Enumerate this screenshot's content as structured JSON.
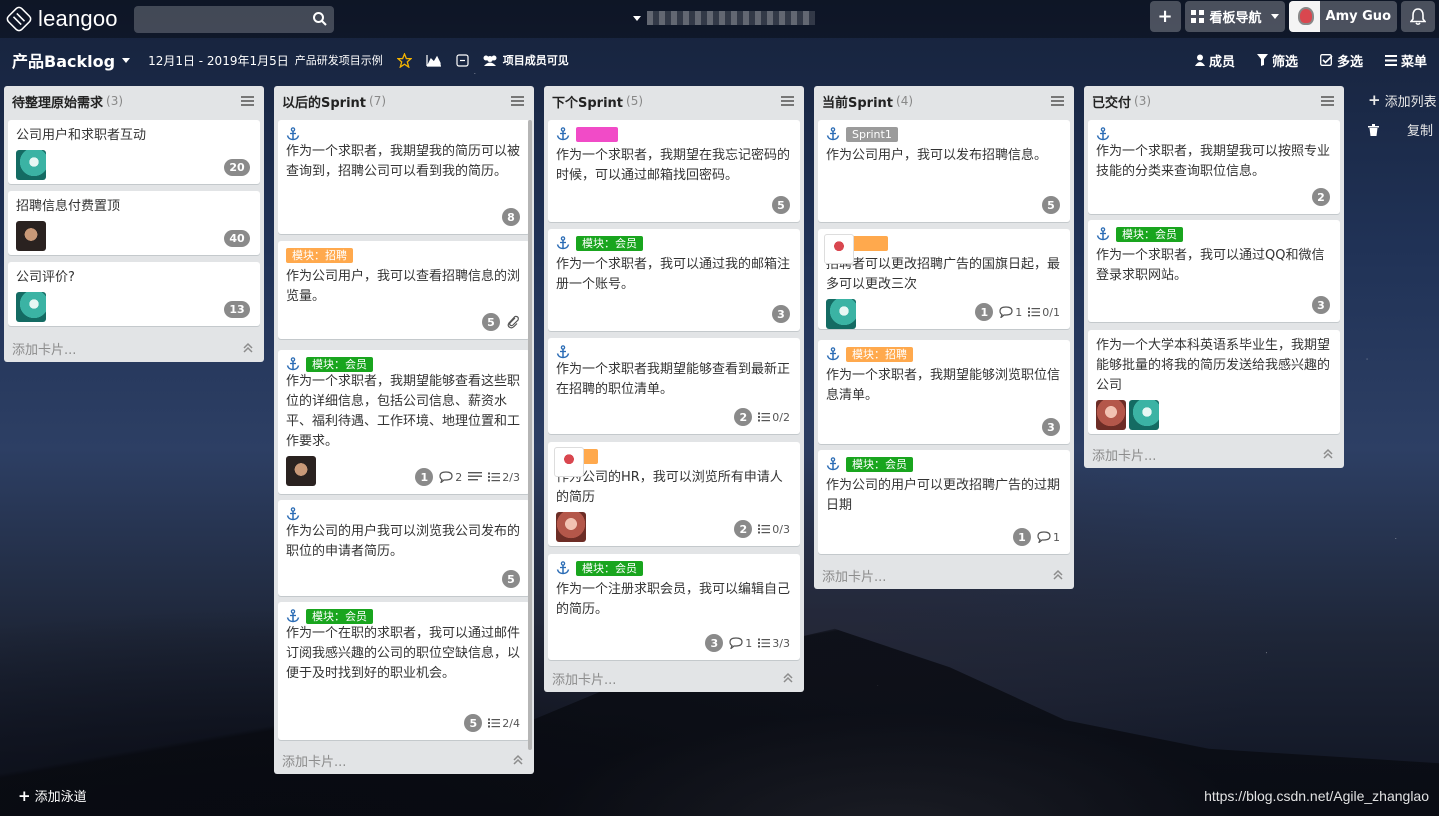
{
  "topbar": {
    "logo_text": "leangoo",
    "search_placeholder": "",
    "board_switch_label": "",
    "nav_label": "看板导航",
    "user_name": "Amy Guo",
    "icons": [
      "search-icon",
      "plus-icon",
      "grid-icon",
      "bell-icon"
    ]
  },
  "board": {
    "title": "产品Backlog",
    "date_range": "12月1日 - 2019年1月5日",
    "description": "产品研发项目示例",
    "visibility": "项目成员可见",
    "actions": [
      "成员",
      "筛选",
      "多选",
      "菜单"
    ]
  },
  "lists": [
    {
      "title": "待整理原始需求",
      "count": "(3)",
      "cards": [
        {
          "text": "公司用户和求职者互动",
          "badge": "20"
        },
        {
          "text": "招聘信息付费置顶",
          "badge": "40"
        },
        {
          "text": "公司评价?",
          "badge": "13"
        }
      ],
      "add_card": "添加卡片..."
    },
    {
      "title": "以后的Sprint",
      "count": "(7)",
      "cards": [
        {
          "text": "作为一个求职者，我期望我的简历可以被查询到，招聘公司可以看到我的简历。",
          "badge": "8"
        },
        {
          "label": "模块：招聘",
          "text": "作为公司用户，我可以查看招聘信息的浏览量。",
          "badge": "5"
        },
        {
          "label": "模块：会员",
          "text": "作为一个求职者，我期望能够查看这些职位的详细信息，包括公司信息、薪资水平、福利待遇、工作环境、地理位置和工作要求。",
          "badge": "1",
          "comments": "2",
          "checklist": "2/3"
        },
        {
          "text": "作为公司的用户我可以浏览我公司发布的职位的申请者简历。",
          "badge": "5"
        },
        {
          "label": "模块：会员",
          "text": "作为一个在职的求职者，我可以通过邮件订阅我感兴趣的公司的职位空缺信息，以便于及时找到好的职业机会。",
          "badge": "5",
          "checklist": "2/4"
        }
      ],
      "add_card": "添加卡片..."
    },
    {
      "title": "下个Sprint",
      "count": "(5)",
      "cards": [
        {
          "text": "作为一个求职者，我期望在我忘记密码的时候，可以通过邮箱找回密码。",
          "badge": "5"
        },
        {
          "label": "模块：会员",
          "text": "作为一个求职者，我可以通过我的邮箱注册一个账号。",
          "badge": "3"
        },
        {
          "text": "作为一个求职者我期望能够查看到最新正在招聘的职位清单。",
          "badge": "2",
          "checklist": "0/2"
        },
        {
          "text": "作为公司的HR，我可以浏览所有申请人的简历",
          "badge": "2",
          "checklist": "0/3"
        },
        {
          "label": "模块：会员",
          "text": "作为一个注册求职会员，我可以编辑自己的简历。",
          "badge": "3",
          "comments": "1",
          "checklist": "3/3"
        }
      ],
      "add_card": "添加卡片..."
    },
    {
      "title": "当前Sprint",
      "count": "(4)",
      "cards": [
        {
          "label": "Sprint1",
          "text": "作为公司用户，我可以发布招聘信息。",
          "badge": "5"
        },
        {
          "text": "招聘者可以更改招聘广告的国旗日起，最多可以更改三次",
          "badge": "1",
          "comments": "1",
          "checklist": "0/1"
        },
        {
          "label": "模块：招聘",
          "text": "作为一个求职者，我期望能够浏览职位信息清单。",
          "badge": "3"
        },
        {
          "label": "模块：会员",
          "text": "作为公司的用户可以更改招聘广告的过期日期",
          "badge": "1",
          "comments": "1"
        }
      ],
      "add_card": "添加卡片..."
    },
    {
      "title": "已交付",
      "count": "(3)",
      "cards": [
        {
          "text": "作为一个求职者，我期望我可以按照专业技能的分类来查询职位信息。",
          "badge": "2"
        },
        {
          "label": "模块：会员",
          "text": "作为一个求职者，我可以通过QQ和微信登录求职网站。",
          "badge": "3"
        },
        {
          "text": "作为一个大学本科英语系毕业生，我期望能够批量的将我的简历发送给我感兴趣的公司"
        }
      ],
      "add_card": "添加卡片..."
    }
  ],
  "side": {
    "add_list": "添加列表",
    "copy": "复制"
  },
  "add_lane": "添加泳道",
  "watermark": "https://blog.csdn.net/Agile_zhanglao",
  "colors": {
    "label_green": "#19a51e",
    "label_orange": "#ffa94d",
    "label_pink": "#f14bc7",
    "badge": "#8a8a8a",
    "list_bg": "#e2e4e6"
  }
}
